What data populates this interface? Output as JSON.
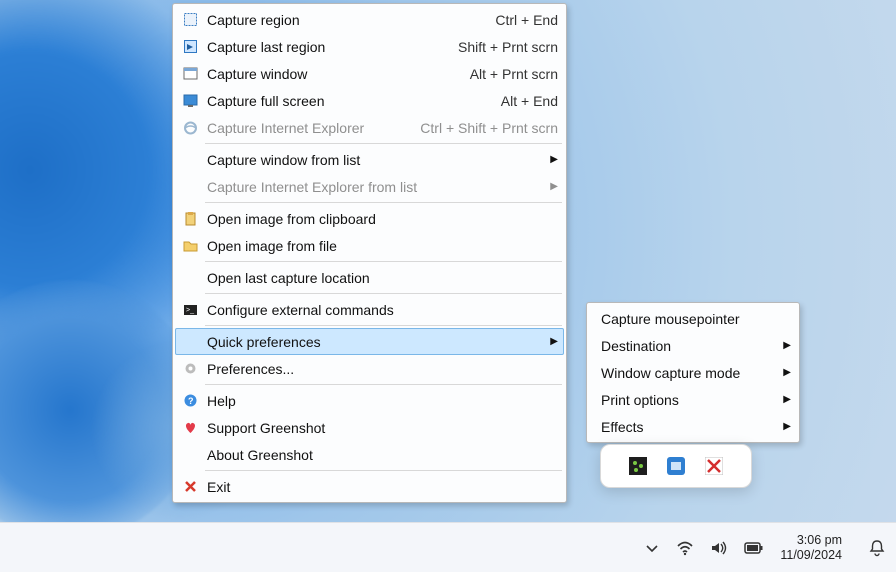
{
  "menu": {
    "capture_region": {
      "label": "Capture region",
      "accel": "Ctrl + End"
    },
    "capture_last_region": {
      "label": "Capture last region",
      "accel": "Shift + Prnt scrn"
    },
    "capture_window": {
      "label": "Capture window",
      "accel": "Alt + Prnt scrn"
    },
    "capture_full_screen": {
      "label": "Capture full screen",
      "accel": "Alt + End"
    },
    "capture_ie": {
      "label": "Capture Internet Explorer",
      "accel": "Ctrl + Shift + Prnt scrn"
    },
    "capture_window_list": {
      "label": "Capture window from list"
    },
    "capture_ie_list": {
      "label": "Capture Internet Explorer from list"
    },
    "open_clipboard": {
      "label": "Open image from clipboard"
    },
    "open_file": {
      "label": "Open image from file"
    },
    "open_last_location": {
      "label": "Open last capture location"
    },
    "configure_ext": {
      "label": "Configure external commands"
    },
    "quick_prefs": {
      "label": "Quick preferences"
    },
    "preferences": {
      "label": "Preferences..."
    },
    "help": {
      "label": "Help"
    },
    "support": {
      "label": "Support Greenshot"
    },
    "about": {
      "label": "About Greenshot"
    },
    "exit": {
      "label": "Exit"
    }
  },
  "submenu": {
    "capture_mouse": {
      "label": "Capture mousepointer"
    },
    "destination": {
      "label": "Destination"
    },
    "window_mode": {
      "label": "Window capture mode"
    },
    "print_options": {
      "label": "Print options"
    },
    "effects": {
      "label": "Effects"
    }
  },
  "taskbar": {
    "time": "3:06 pm",
    "date": "11/09/2024"
  }
}
